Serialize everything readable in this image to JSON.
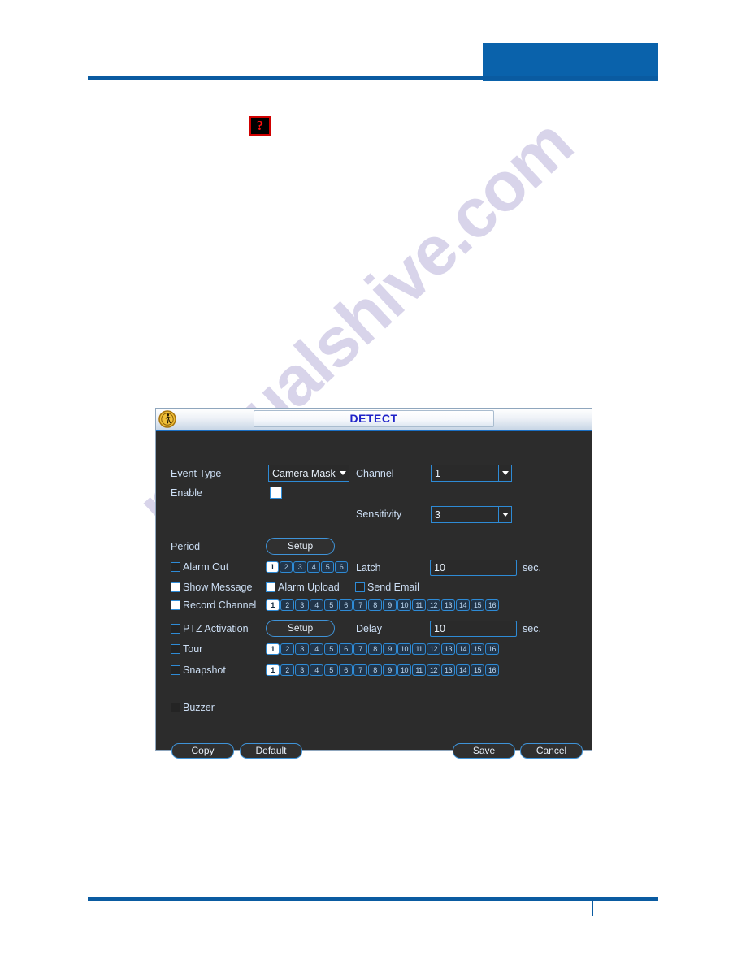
{
  "page": {
    "watermark_text": "manualshive.com",
    "broken_image_glyph": "?",
    "accent_color": "#0a5ba1",
    "header_block_color": "#0a62ab"
  },
  "dialog": {
    "title": "DETECT",
    "title_icon": "motion-detect-person-icon",
    "fields": {
      "event_type_label": "Event Type",
      "event_type_value": "Camera Maski",
      "channel_label": "Channel",
      "channel_value": "1",
      "enable_label": "Enable",
      "enable_checked": true,
      "sensitivity_label": "Sensitivity",
      "sensitivity_value": "3"
    },
    "period": {
      "label": "Period",
      "setup_label": "Setup"
    },
    "alarm_out": {
      "label": "Alarm Out",
      "checked": false,
      "channels": [
        "1",
        "2",
        "3",
        "4",
        "5",
        "6"
      ],
      "selected": [
        "1"
      ]
    },
    "latch": {
      "label": "Latch",
      "value": "10",
      "unit": "sec."
    },
    "show_message": {
      "label": "Show Message",
      "checked": true
    },
    "alarm_upload": {
      "label": "Alarm Upload",
      "checked": true
    },
    "send_email": {
      "label": "Send Email",
      "checked": false
    },
    "record_channel": {
      "label": "Record Channel",
      "checked": true,
      "channels": [
        "1",
        "2",
        "3",
        "4",
        "5",
        "6",
        "7",
        "8",
        "9",
        "10",
        "11",
        "12",
        "13",
        "14",
        "15",
        "16"
      ],
      "selected": [
        "1"
      ]
    },
    "ptz_activation": {
      "label": "PTZ Activation",
      "checked": false,
      "setup_label": "Setup"
    },
    "delay": {
      "label": "Delay",
      "value": "10",
      "unit": "sec."
    },
    "tour": {
      "label": "Tour",
      "checked": false,
      "channels": [
        "1",
        "2",
        "3",
        "4",
        "5",
        "6",
        "7",
        "8",
        "9",
        "10",
        "11",
        "12",
        "13",
        "14",
        "15",
        "16"
      ],
      "selected": [
        "1"
      ]
    },
    "snapshot": {
      "label": "Snapshot",
      "checked": false,
      "channels": [
        "1",
        "2",
        "3",
        "4",
        "5",
        "6",
        "7",
        "8",
        "9",
        "10",
        "11",
        "12",
        "13",
        "14",
        "15",
        "16"
      ],
      "selected": [
        "1"
      ]
    },
    "buzzer": {
      "label": "Buzzer",
      "checked": false
    },
    "buttons": {
      "copy": "Copy",
      "default": "Default",
      "save": "Save",
      "cancel": "Cancel"
    }
  }
}
